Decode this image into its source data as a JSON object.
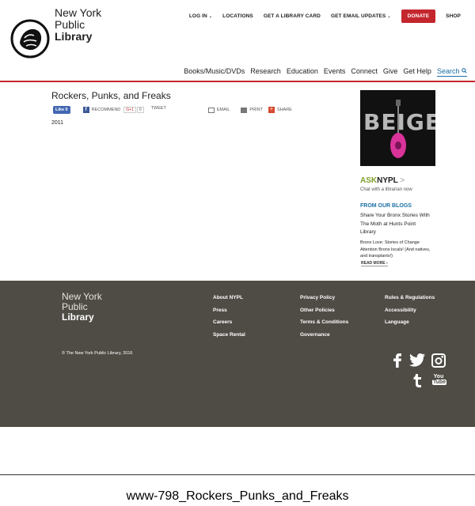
{
  "header": {
    "logo_line1": "New York",
    "logo_line2": "Public",
    "logo_line3": "Library",
    "utility": {
      "login": "LOG IN",
      "locations": "LOCATIONS",
      "library_card": "GET A LIBRARY CARD",
      "email_updates": "GET EMAIL UPDATES",
      "donate": "DONATE",
      "shop": "SHOP"
    },
    "nav": [
      "Books/Music/DVDs",
      "Research",
      "Education",
      "Events",
      "Connect",
      "Give",
      "Get Help"
    ],
    "search_label": "Search"
  },
  "main": {
    "title": "Rockers, Punks, and Freaks",
    "share": {
      "like": "Like 0",
      "recommend": "RECOMMEND",
      "gplus": "G+1",
      "gcount": "0",
      "tweet": "TWEET",
      "email": "EMAIL",
      "print": "PRINT",
      "share": "SHARE"
    },
    "year": "2011"
  },
  "sidebar": {
    "promo_text": "BEIGE",
    "ask_a": "ASK",
    "ask_b": "NYPL",
    "ask_arrow": ">",
    "chat": "Chat with a librarian now",
    "blogs_heading": "FROM OUR BLOGS",
    "blog1": "Share Your Bronx Stories With The Moth at Hunts Point Library",
    "blog2": "Bronx Love: Stories of Change Attention Bronx locals! (And natives, and transplants!)",
    "read_more": "READ MORE ›"
  },
  "footer": {
    "logo_line1": "New York",
    "logo_line2": "Public",
    "logo_line3": "Library",
    "col1": [
      "About NYPL",
      "Press",
      "Careers",
      "Space Rental"
    ],
    "col2": [
      "Privacy Policy",
      "Other Policies",
      "Terms & Conditions",
      "Governance"
    ],
    "col3": [
      "Rules & Regulations",
      "Accessibility",
      "Language"
    ],
    "copyright": "© The New York Public Library, 2016",
    "youtube_a": "You",
    "youtube_b": "Tube"
  },
  "caption": "www-798_Rockers_Punks_and_Freaks",
  "colors": {
    "accent": "#c4262e",
    "link": "#1b6ea6",
    "footer_bg": "#4f4c45",
    "ask_green": "#7e9e2d"
  }
}
